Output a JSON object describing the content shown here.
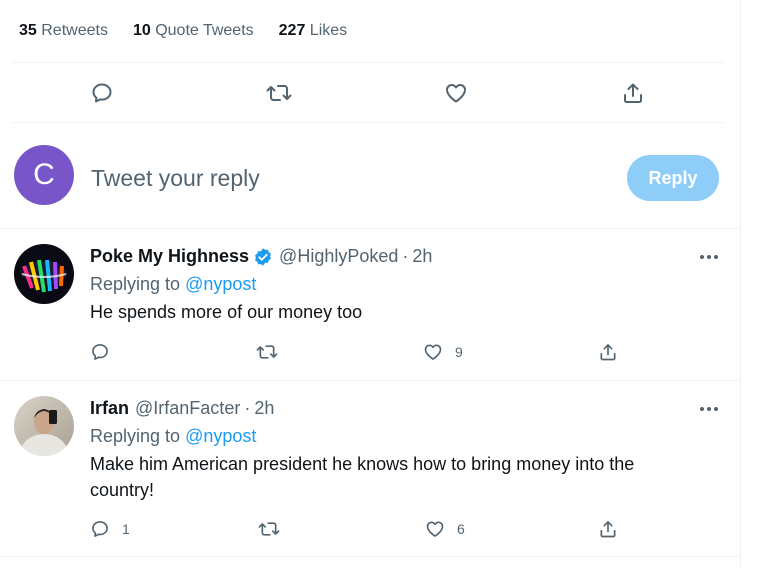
{
  "stats": [
    {
      "count": "35",
      "label": "Retweets"
    },
    {
      "count": "10",
      "label": "Quote Tweets"
    },
    {
      "count": "227",
      "label": "Likes"
    }
  ],
  "composer": {
    "avatar_letter": "C",
    "placeholder": "Tweet your reply",
    "reply_label": "Reply"
  },
  "replies": [
    {
      "name": "Poke My Highness",
      "verified": true,
      "handle": "@HighlyPoked",
      "dot": "·",
      "time": "2h",
      "replying_prefix": "Replying to",
      "replying_to": "@nypost",
      "text": "He spends more of our money too",
      "reply_count": "",
      "retweet_count": "",
      "like_count": "9"
    },
    {
      "name": "Irfan",
      "verified": false,
      "handle": "@IrfanFacter",
      "dot": "·",
      "time": "2h",
      "replying_prefix": "Replying to",
      "replying_to": "@nypost",
      "text": "Make him American president he knows how to bring money into the country!",
      "reply_count": "1",
      "retweet_count": "",
      "like_count": "6"
    }
  ],
  "colors": {
    "accent": "#1d9bf0",
    "reply_button": "#8ecdf7",
    "avatar": "#7856c9",
    "secondary_text": "#536471"
  },
  "icons": [
    "comment-icon",
    "retweet-icon",
    "heart-icon",
    "share-icon",
    "more-icon",
    "verified-badge-icon"
  ]
}
